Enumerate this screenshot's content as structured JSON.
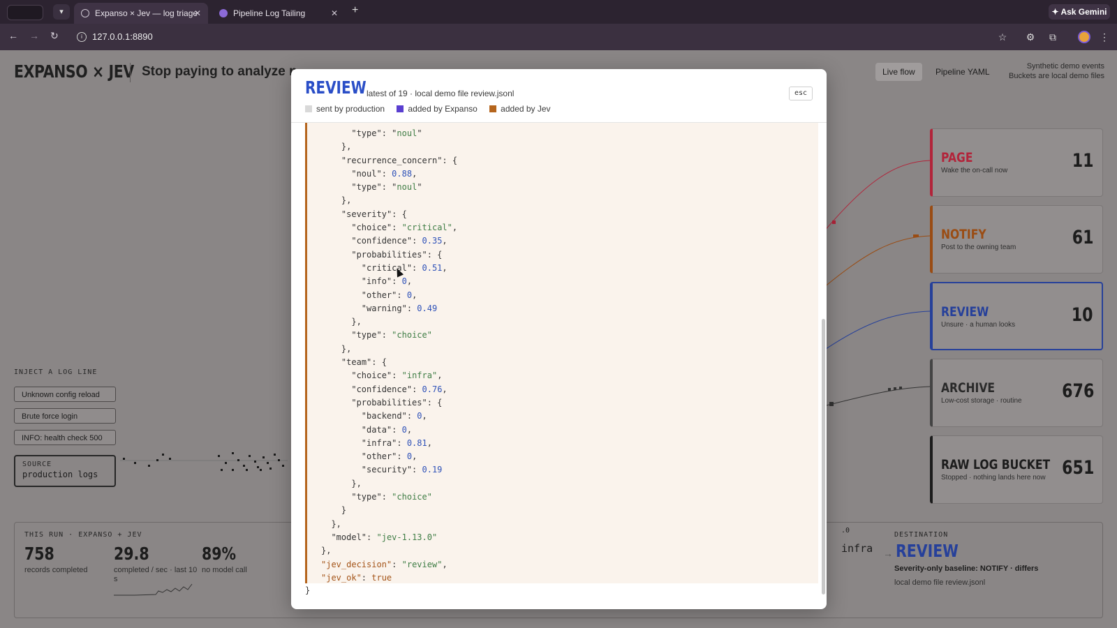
{
  "browser": {
    "tabs": [
      {
        "label": "Expanso × Jev — log triage"
      },
      {
        "label": "Pipeline Log Tailing"
      }
    ],
    "url": "127.0.0.1:8890",
    "ask_gemini": "Ask Gemini"
  },
  "app": {
    "brand": "EXPANSO × JEV",
    "headline": "Stop paying to analyze n",
    "tabs": [
      {
        "label": "Live flow"
      },
      {
        "label": "Pipeline YAML"
      }
    ],
    "note_line1": "Synthetic demo events",
    "note_line2": "Buckets are local demo files",
    "inject": {
      "title": "INJECT A LOG LINE",
      "buttons": [
        {
          "label": "Unknown config reload"
        },
        {
          "label": "Brute force login"
        },
        {
          "label": "INFO: health check 500"
        }
      ]
    },
    "source": {
      "key": "SOURCE",
      "value": "production logs"
    },
    "destinations": [
      {
        "name": "PAGE",
        "sub": "Wake the on-call now",
        "count": "11",
        "color": "#b2243a"
      },
      {
        "name": "NOTIFY",
        "sub": "Post to the owning team",
        "count": "61",
        "color": "#9a4c13"
      },
      {
        "name": "REVIEW",
        "sub": "Unsure · a human looks",
        "count": "10",
        "color": "#26409a"
      },
      {
        "name": "ARCHIVE",
        "sub": "Low-cost storage · routine",
        "count": "676",
        "color": "#2a2a2a"
      },
      {
        "name": "RAW LOG BUCKET",
        "sub": "Stopped · nothing lands here now",
        "count": "651",
        "color": "#1c1c1c"
      }
    ],
    "stats": {
      "title": "THIS RUN · EXPANSO + JEV",
      "items": [
        {
          "value": "758",
          "label": "records completed"
        },
        {
          "value": "29.8",
          "label": "completed / sec · last 10 s"
        },
        {
          "value": "89%",
          "label": "no model call"
        }
      ],
      "fragment_num": ".0",
      "fragment_team": "infra",
      "destination": {
        "key": "DESTINATION",
        "value": "REVIEW",
        "baseline": "Severity-only baseline: NOTIFY · differs",
        "file": "local demo file review.jsonl"
      }
    }
  },
  "modal": {
    "title": "REVIEW",
    "subtitle": "latest of 19 · local demo file review.jsonl",
    "esc": "esc",
    "legend": [
      {
        "label": "sent by production",
        "color": "#d9d9d9"
      },
      {
        "label": "added by Expanso",
        "color": "#5a3fd0"
      },
      {
        "label": "added by Jev",
        "color": "#b5651d"
      }
    ],
    "code": {
      "type_noul": "noul",
      "recurrence_concern_key": "recurrence_concern",
      "recurrence_noul": "0.88",
      "severity_key": "severity",
      "severity_choice": "critical",
      "severity_confidence": "0.35",
      "sev_prob_critical": "0.51",
      "sev_prob_info": "0",
      "sev_prob_other": "0",
      "sev_prob_warning": "0.49",
      "type_choice": "choice",
      "team_key": "team",
      "team_choice": "infra",
      "team_confidence": "0.76",
      "team_prob_backend": "0",
      "team_prob_data": "0",
      "team_prob_infra": "0.81",
      "team_prob_other": "0",
      "team_prob_security": "0.19",
      "model": "jev-1.13.0",
      "jev_decision": "review",
      "jev_ok": "true"
    }
  }
}
